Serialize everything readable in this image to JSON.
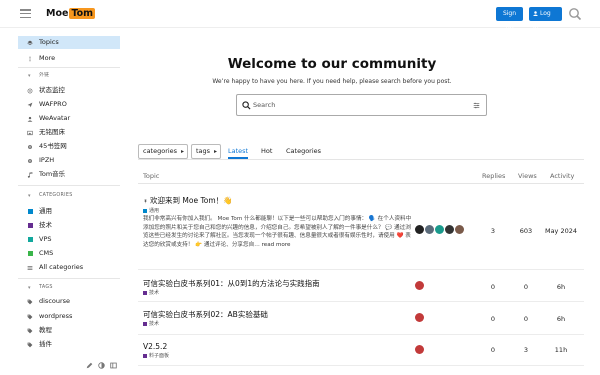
{
  "header": {
    "logo_part1": "Moe",
    "logo_part2": "Tom",
    "signup_label": "Sign Up",
    "login_label": "Log In"
  },
  "sidebar": {
    "top_items": [
      {
        "label": "Topics",
        "icon": "layers-icon"
      },
      {
        "label": "More",
        "icon": "more-vertical-icon"
      }
    ],
    "links_heading": "外链",
    "links": [
      {
        "label": "状态监控",
        "icon": "pulse-icon"
      },
      {
        "label": "WAFPRO",
        "icon": "send-icon"
      },
      {
        "label": "WeAvatar",
        "icon": "user-icon"
      },
      {
        "label": "无铭图床",
        "icon": "image-icon"
      },
      {
        "label": "45书签网",
        "icon": "gear-icon"
      },
      {
        "label": "IPZH",
        "icon": "gear-icon"
      },
      {
        "label": "Tom音乐",
        "icon": "music-icon"
      }
    ],
    "categories_heading": "CATEGORIES",
    "categories": [
      {
        "label": "通用",
        "color": "#0088cc"
      },
      {
        "label": "技术",
        "color": "#652d90"
      },
      {
        "label": "VPS",
        "color": "#12a89d"
      },
      {
        "label": "CMS",
        "color": "#3ab54a"
      }
    ],
    "all_categories_label": "All categories",
    "tags_heading": "TAGS",
    "tags": [
      {
        "label": "discourse"
      },
      {
        "label": "wordpress"
      },
      {
        "label": "教程"
      },
      {
        "label": "插件"
      }
    ]
  },
  "hero": {
    "title": "Welcome to our community",
    "subtitle": "We’re happy to have you here. If you need help, please search before you post.",
    "search_placeholder": "Search"
  },
  "nav": {
    "categories_dropdown": "categories",
    "tags_dropdown": "tags",
    "tabs": [
      "Latest",
      "Hot",
      "Categories"
    ],
    "active_tab": "Latest"
  },
  "table": {
    "headers": {
      "topic": "Topic",
      "replies": "Replies",
      "views": "Views",
      "activity": "Activity"
    },
    "rows": [
      {
        "title": "欢迎来到 Moe Tom！👋",
        "category": "通用",
        "category_color": "#0088cc",
        "pinned": true,
        "excerpt": "我们非常高兴有你加入我们。 Moe Tom 什么都能聊！以下是一些可以帮助您入门的事情： 🗣️ 在个人资料中添加您的照片和关于您自己和您的兴趣的信息，介绍您自己。您希望被别人了解的一件事是什么？ 💬 通过浏览这些已经发生的讨论来了解社区。当您发现一个帖子很有趣、信息量很大或者很有娱乐性时，请使用 ❤️ 表达您的欣赏或支持！ 👉 通过评论、分享您自…",
        "read_more": "read more",
        "replies": "3",
        "views": "603",
        "activity": "May 2024"
      },
      {
        "title": "可信实验白皮书系列01：从0到1的方法论与实践指南",
        "category": "技术",
        "category_color": "#652d90",
        "replies": "0",
        "views": "0",
        "activity": "6h"
      },
      {
        "title": "可信实验白皮书系列02：AB实验基础",
        "category": "技术",
        "category_color": "#652d90",
        "replies": "0",
        "views": "0",
        "activity": "6h"
      },
      {
        "title": "V2.5.2",
        "category": "料子面板",
        "category_color": "#652d90",
        "replies": "0",
        "views": "3",
        "activity": "11h"
      }
    ]
  }
}
